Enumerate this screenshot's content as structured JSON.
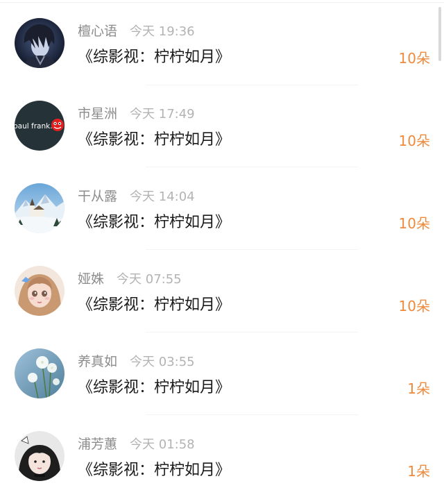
{
  "gift_list": {
    "items": [
      {
        "user": "檀心语",
        "time": "今天 19:36",
        "title": "《综影视：柠柠如月》",
        "amount": "10朵",
        "avatar_icon": "anime-boy-avatar-icon"
      },
      {
        "user": "市星洲",
        "time": "今天 17:49",
        "title": "《综影视：柠柠如月》",
        "amount": "10朵",
        "avatar_icon": "paul-frank-logo-avatar-icon",
        "avatar_logo_text": "paul frank."
      },
      {
        "user": "干从露",
        "time": "今天 14:04",
        "title": "《综影视：柠柠如月》",
        "amount": "10朵",
        "avatar_icon": "snowy-church-avatar-icon"
      },
      {
        "user": "娅姝",
        "time": "今天 07:55",
        "title": "《综影视：柠柠如月》",
        "amount": "10朵",
        "avatar_icon": "anime-girl-avatar-icon"
      },
      {
        "user": "养真如",
        "time": "今天 03:55",
        "title": "《综影视：柠柠如月》",
        "amount": "1朵",
        "avatar_icon": "white-flowers-avatar-icon"
      },
      {
        "user": "浦芳蕙",
        "time": "今天 01:58",
        "title": "《综影视：柠柠如月》",
        "amount": "1朵",
        "avatar_icon": "girl-photo-avatar-icon"
      }
    ]
  },
  "colors": {
    "amount": "#ef8a3c",
    "username": "#8c8c8c",
    "time": "#b3b3b3",
    "title": "#1a1a1a"
  }
}
